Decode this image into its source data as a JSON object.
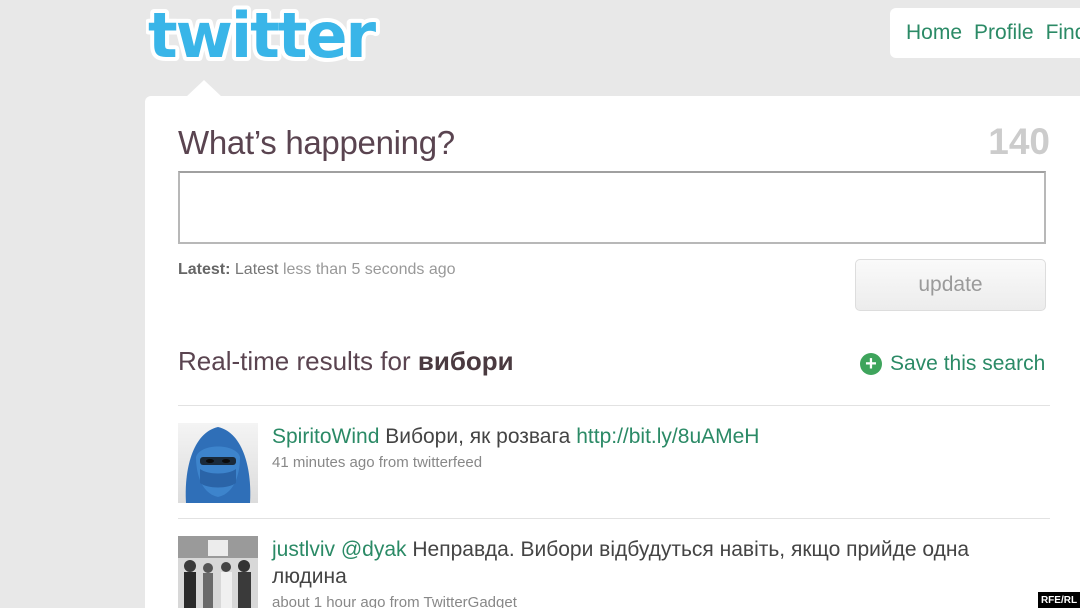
{
  "logo": {
    "text": "twitter",
    "color": "#39b5e8"
  },
  "nav": {
    "items": [
      "Home",
      "Profile",
      "Find"
    ]
  },
  "composer": {
    "prompt": "What’s happening?",
    "char_count": "140",
    "input_value": "",
    "latest_label": "Latest:",
    "latest_text": "Latest",
    "latest_time": "less than 5 seconds ago",
    "update_label": "update"
  },
  "results": {
    "title_prefix": "Real-time results for",
    "query": "вибори",
    "save_label": "Save this search"
  },
  "tweets": [
    {
      "user": "SpiritoWind",
      "text": "Вибори, як розвага",
      "link": "http://bit.ly/8uAMeH",
      "meta": "41 minutes ago from twitterfeed",
      "avatar": "blue-veiled-face"
    },
    {
      "user": "justlviv",
      "mention": "@dyak",
      "text": "Неправда. Вибори відбудуться навіть, якщо прийде одна людина",
      "meta": "about 1 hour ago from TwitterGadget",
      "avatar": "black-and-white-group-photo"
    }
  ],
  "watermark": "RFE/RL",
  "colors": {
    "accent_green": "#2b8a66",
    "background": "#e8e8e8",
    "text_heading": "#5a4450"
  }
}
